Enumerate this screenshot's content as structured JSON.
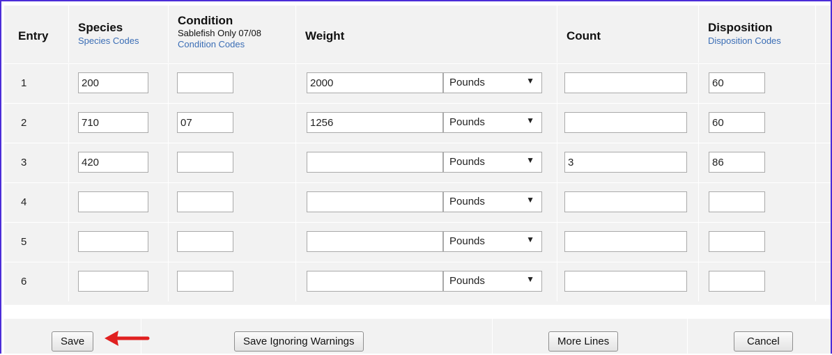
{
  "headers": {
    "entry": "Entry",
    "species": "Species",
    "species_link": "Species Codes",
    "condition": "Condition",
    "condition_sub": "Sablefish Only 07/08",
    "condition_link": "Condition Codes",
    "weight": "Weight",
    "count": "Count",
    "disposition": "Disposition",
    "disposition_link": "Disposition Codes"
  },
  "rows": [
    {
      "entry": "1",
      "species": "200",
      "condition": "",
      "weight": "2000",
      "unit": "Pounds",
      "count": "",
      "disposition": "60"
    },
    {
      "entry": "2",
      "species": "710",
      "condition": "07",
      "weight": "1256",
      "unit": "Pounds",
      "count": "",
      "disposition": "60"
    },
    {
      "entry": "3",
      "species": "420",
      "condition": "",
      "weight": "",
      "unit": "Pounds",
      "count": "3",
      "disposition": "86"
    },
    {
      "entry": "4",
      "species": "",
      "condition": "",
      "weight": "",
      "unit": "Pounds",
      "count": "",
      "disposition": ""
    },
    {
      "entry": "5",
      "species": "",
      "condition": "",
      "weight": "",
      "unit": "Pounds",
      "count": "",
      "disposition": ""
    },
    {
      "entry": "6",
      "species": "",
      "condition": "",
      "weight": "",
      "unit": "Pounds",
      "count": "",
      "disposition": ""
    }
  ],
  "buttons": {
    "save": "Save",
    "save_ignoring": "Save Ignoring Warnings",
    "more_lines": "More Lines",
    "cancel": "Cancel"
  },
  "colors": {
    "frame_border": "#4b2dd8",
    "link": "#3a6db5",
    "arrow": "#e02020",
    "cell_bg": "#f2f2f2"
  }
}
